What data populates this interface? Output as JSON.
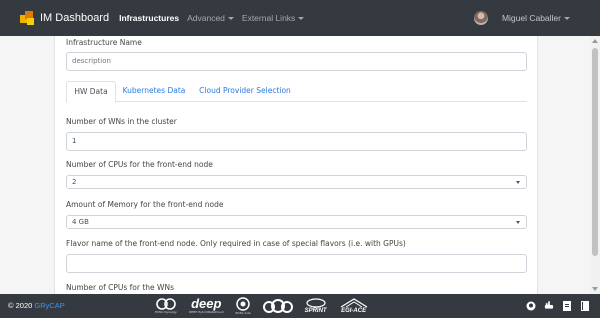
{
  "navbar": {
    "brand": "IM Dashboard",
    "items": [
      {
        "label": "Infrastructures",
        "active": true,
        "dropdown": false
      },
      {
        "label": "Advanced",
        "active": false,
        "dropdown": true
      },
      {
        "label": "External Links",
        "active": false,
        "dropdown": true
      }
    ],
    "user": "Miguel Caballer"
  },
  "form": {
    "infra_name_label": "Infrastructure Name",
    "infra_name_placeholder": "description",
    "tabs": [
      {
        "label": "HW Data",
        "active": true
      },
      {
        "label": "Kubernetes Data",
        "active": false
      },
      {
        "label": "Cloud Provider Selection",
        "active": false
      }
    ],
    "fields": [
      {
        "label": "Number of WNs in the cluster",
        "value": "1",
        "type": "input"
      },
      {
        "label": "Number of CPUs for the front-end node",
        "value": "2",
        "type": "select"
      },
      {
        "label": "Amount of Memory for the front-end node",
        "value": "4 GB",
        "type": "select"
      },
      {
        "label": "Flavor name of the front-end node. Only required in case of special flavors (i.e. with GPUs)",
        "value": "",
        "type": "input"
      },
      {
        "label": "Number of CPUs for the WNs",
        "value": "",
        "type": "partial"
      }
    ]
  },
  "footer": {
    "copyright": "© 2020",
    "link": "GRyCAP",
    "logos": [
      {
        "mark": "EOSC",
        "sub": "EOSC-Synergy"
      },
      {
        "mark": "deep",
        "sub": "DEEP HybridDataCloud"
      },
      {
        "mark": "EOSC",
        "sub": "EOSC-hub"
      },
      {
        "mark": "IGN",
        "sub": "cloud"
      },
      {
        "mark": "SPRINT",
        "sub": ""
      },
      {
        "mark": "EGI-ACE",
        "sub": ""
      }
    ],
    "icons": [
      "github-icon",
      "docker-icon",
      "document-icon",
      "book-icon"
    ]
  },
  "colors": {
    "navbar": "#343a40",
    "link": "#2a7ae2",
    "gr_link": "#4a90e2"
  }
}
